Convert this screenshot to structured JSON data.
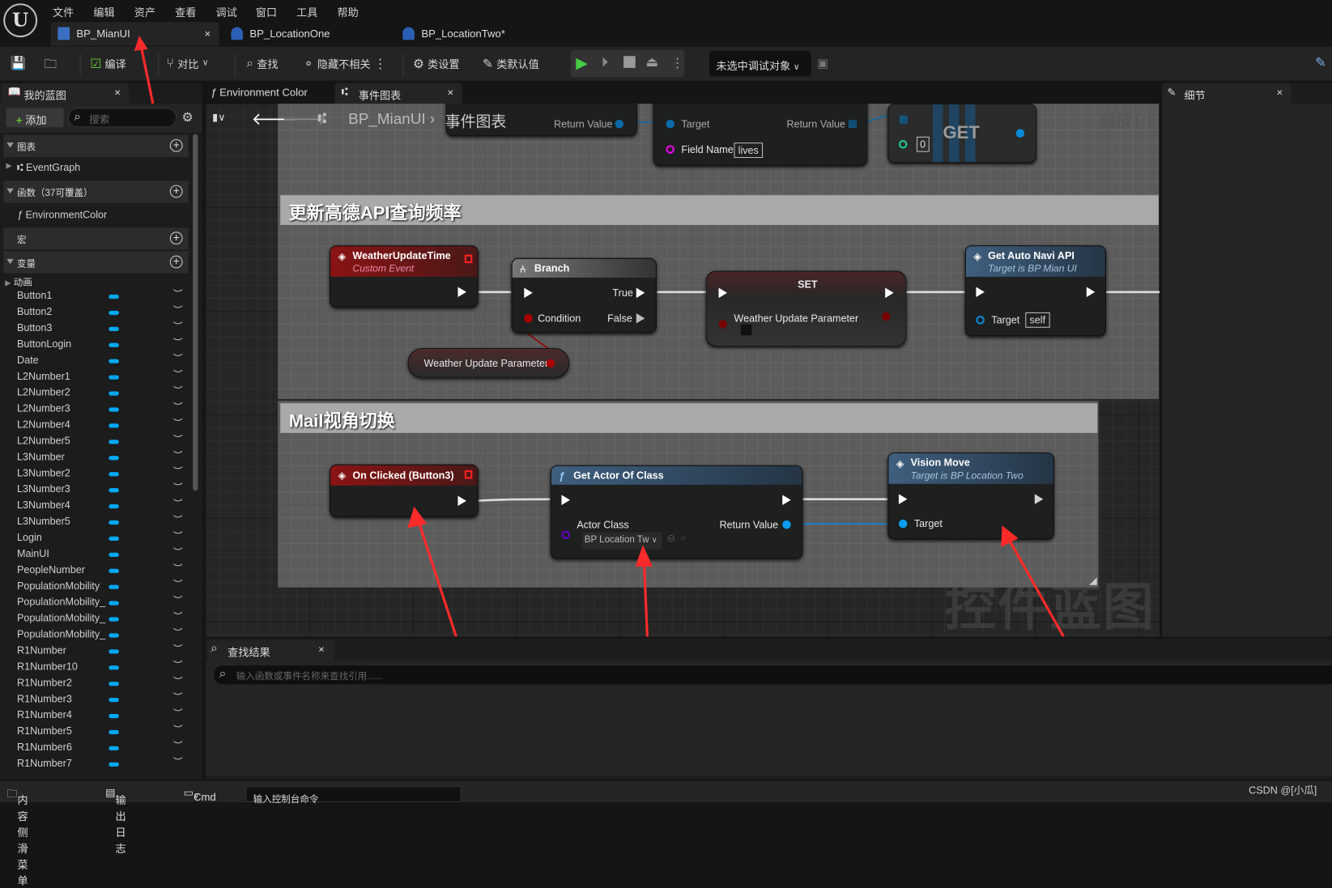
{
  "menu": [
    "文件",
    "编辑",
    "资产",
    "查看",
    "调试",
    "窗口",
    "工具",
    "帮助"
  ],
  "doc_tabs": [
    {
      "label": "BP_MianUI",
      "active": true
    },
    {
      "label": "BP_LocationOne"
    },
    {
      "label": "BP_LocationTwo*"
    }
  ],
  "toolbar": {
    "compile": "编译",
    "diff": "对比",
    "find": "查找",
    "hide_unrelated": "隐藏不相关",
    "class_settings": "类设置",
    "class_defaults": "类默认值",
    "debug_target": "未选中调试对象"
  },
  "my_blueprint": {
    "title": "我的蓝图",
    "add": "添加",
    "search_placeholder": "搜索",
    "sections": {
      "graphs": "图表",
      "functions": "函数（37可覆盖）",
      "macros": "宏",
      "variables": "变量"
    },
    "graph_item": "EventGraph",
    "function_item": "EnvironmentColor",
    "var_category": "动画",
    "variables": [
      "Button1",
      "Button2",
      "Button3",
      "ButtonLogin",
      "Date",
      "L2Number1",
      "L2Number2",
      "L2Number3",
      "L2Number4",
      "L2Number5",
      "L3Number",
      "L3Number2",
      "L3Number3",
      "L3Number4",
      "L3Number5",
      "Login",
      "MainUI",
      "PeopleNumber",
      "PopulationMobility",
      "PopulationMobility_",
      "PopulationMobility_",
      "PopulationMobility_",
      "R1Number",
      "R1Number10",
      "R1Number2",
      "R1Number3",
      "R1Number4",
      "R1Number5",
      "R1Number6",
      "R1Number7"
    ]
  },
  "graph_tabs": [
    {
      "label": "Environment Color"
    },
    {
      "label": "事件图表",
      "active": true
    }
  ],
  "breadcrumb": {
    "root": "BP_MianUI",
    "current": "事件图表"
  },
  "zoom": "缩放1:1",
  "watermark": "控件蓝图",
  "comments": [
    "更新高德API查询频率",
    "Mail视角切换"
  ],
  "top_nodes": {
    "return_value": "Return Value",
    "target": "Target",
    "field_name": "Field Name",
    "field_value": "lives",
    "get": "GET",
    "index": "0"
  },
  "nodes": {
    "weather_event": {
      "title": "WeatherUpdateTime",
      "subtitle": "Custom Event"
    },
    "branch": {
      "title": "Branch",
      "true": "True",
      "false": "False",
      "condition": "Condition"
    },
    "weather_param": "Weather Update Parameter",
    "set": {
      "title": "SET",
      "param": "Weather Update Parameter"
    },
    "navi": {
      "title": "Get Auto Navi API",
      "subtitle": "Target is BP Mian UI",
      "target": "Target",
      "self": "self"
    },
    "onclick": {
      "title": "On Clicked (Button3)"
    },
    "getactor": {
      "title": "Get Actor Of Class",
      "actor_class": "Actor Class",
      "class_value": "BP Location Tw",
      "return_value": "Return Value"
    },
    "vision": {
      "title": "Vision Move",
      "subtitle": "Target is BP Location Two",
      "target": "Target"
    }
  },
  "details": {
    "title": "细节"
  },
  "find_results": {
    "title": "查找结果",
    "placeholder": "输入函数或事件名称来查找引用......"
  },
  "status": {
    "content_drawer": "内容侧滑菜单",
    "output_log": "输出日志",
    "cmd": "Cmd",
    "console_placeholder": "输入控制台命令",
    "credit": "CSDN @[小瓜]"
  },
  "colors": {
    "accent_blue": "#00a8f0",
    "event_red": "#8a1414",
    "annotation_arrow": "#ff3030"
  }
}
